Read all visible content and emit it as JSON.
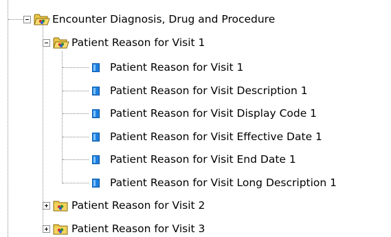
{
  "tree": {
    "root": {
      "label": "Encounter Diagnosis, Drug and Procedure",
      "expanded": true,
      "icon": "folder-open-icon"
    },
    "group1": {
      "label": "Patient Reason for Visit 1",
      "expanded": true,
      "icon": "folder-open-icon",
      "children": [
        {
          "label": "Patient Reason for Visit 1",
          "icon": "field-icon"
        },
        {
          "label": "Patient Reason for Visit Description 1",
          "icon": "field-icon"
        },
        {
          "label": "Patient Reason for Visit Display Code 1",
          "icon": "field-icon"
        },
        {
          "label": "Patient Reason for Visit Effective Date 1",
          "icon": "field-icon"
        },
        {
          "label": "Patient Reason for Visit End Date 1",
          "icon": "field-icon"
        },
        {
          "label": "Patient Reason for Visit Long Description 1",
          "icon": "field-icon"
        }
      ]
    },
    "group2": {
      "label": "Patient Reason for Visit 2",
      "expanded": false,
      "icon": "folder-closed-icon"
    },
    "group3": {
      "label": "Patient Reason for Visit 3",
      "expanded": false,
      "icon": "folder-closed-icon"
    }
  }
}
